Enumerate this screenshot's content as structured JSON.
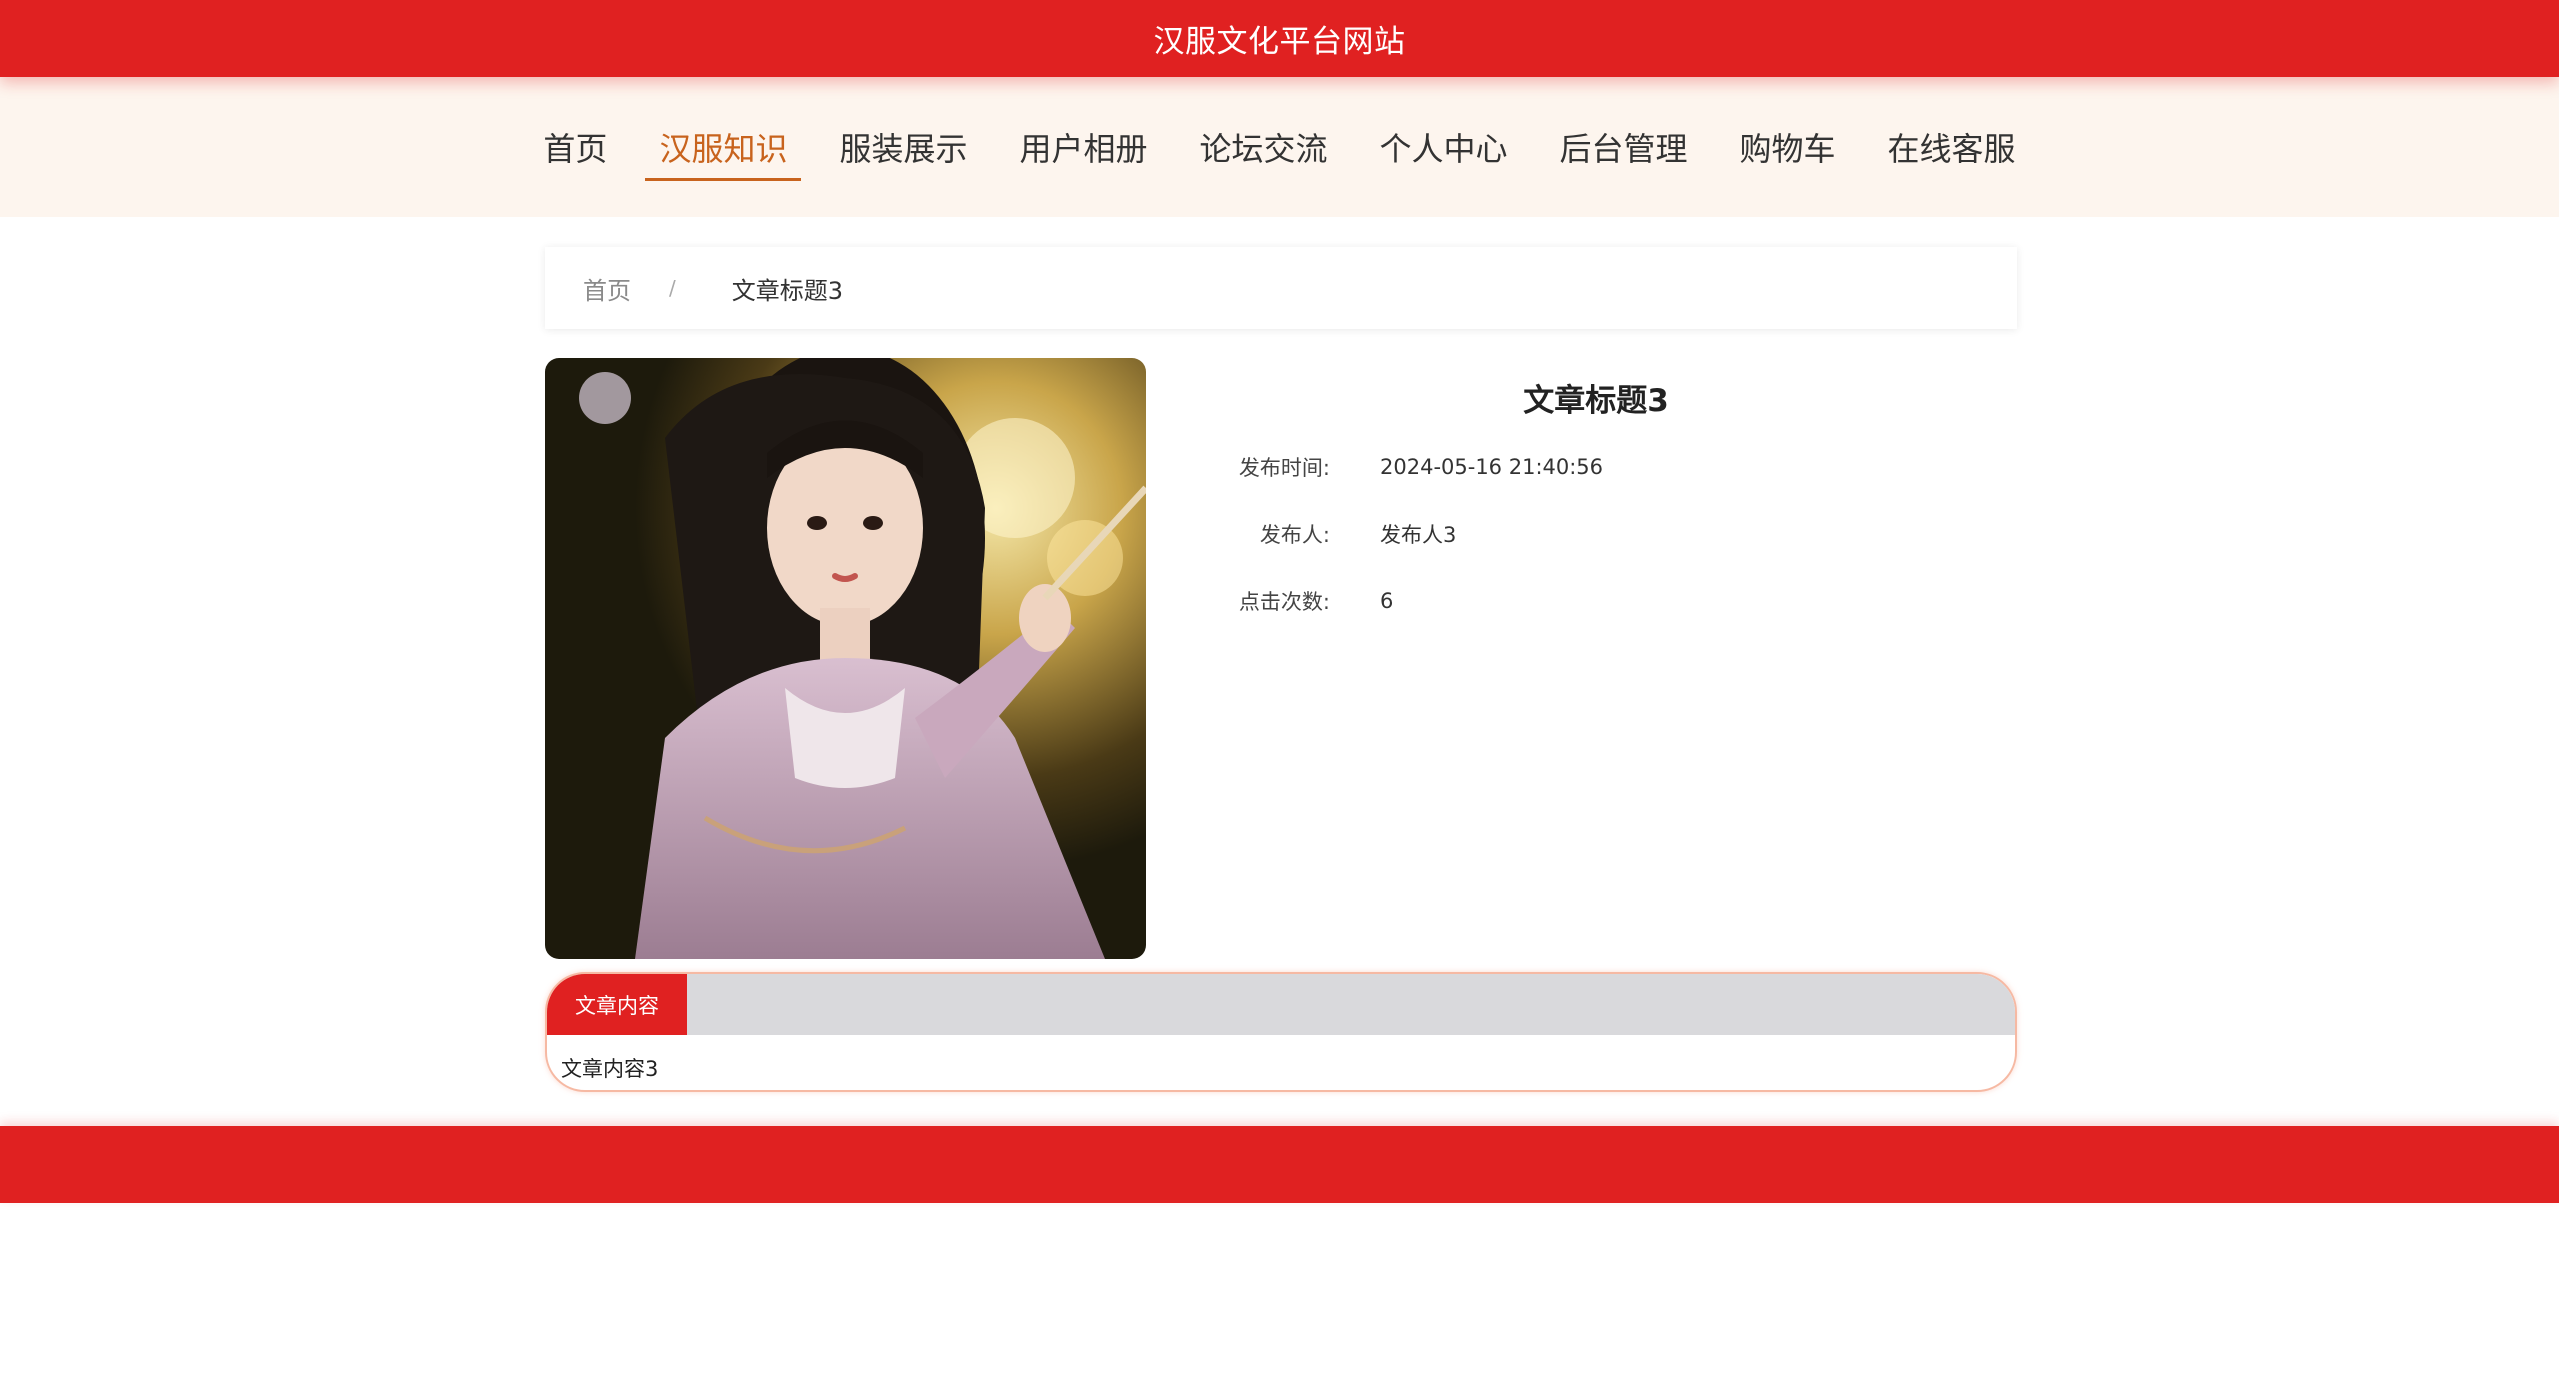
{
  "header": {
    "site_title": "汉服文化平台网站"
  },
  "nav": {
    "items": [
      {
        "label": "首页"
      },
      {
        "label": "汉服知识"
      },
      {
        "label": "服装展示"
      },
      {
        "label": "用户相册"
      },
      {
        "label": "论坛交流"
      },
      {
        "label": "个人中心"
      },
      {
        "label": "后台管理"
      },
      {
        "label": "购物车"
      },
      {
        "label": "在线客服"
      }
    ],
    "active_index": 1
  },
  "breadcrumb": {
    "home": "首页",
    "separator": "/",
    "current": "文章标题3"
  },
  "article": {
    "title": "文章标题3",
    "meta": [
      {
        "label": "发布时间:",
        "value": "2024-05-16 21:40:56"
      },
      {
        "label": "发布人:",
        "value": "发布人3"
      },
      {
        "label": "点击次数:",
        "value": "6"
      }
    ],
    "content_tab": "文章内容",
    "content": "文章内容3"
  },
  "colors": {
    "primary": "#e02121",
    "nav_active": "#c8631d",
    "nav_bg": "#fdf5ee"
  }
}
